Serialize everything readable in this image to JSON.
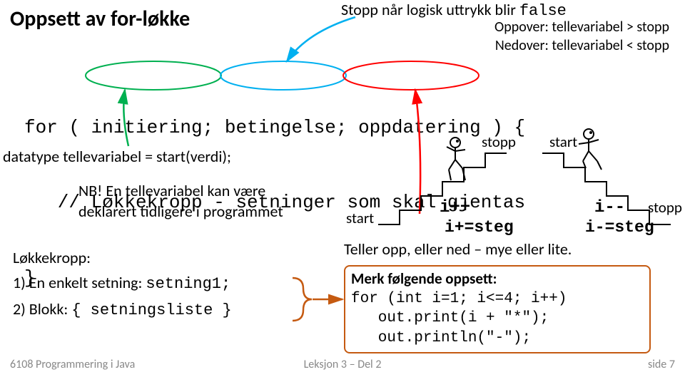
{
  "title": "Oppsett av for-løkke",
  "stop_note_a": "Stopp når logisk uttrykk blir ",
  "stop_note_b": "false",
  "oppover": "Oppover:  tellevariabel > stopp",
  "nedover": "Nedover:  tellevariabel < stopp",
  "code_line1": "for ( initiering; betingelse; oppdatering ) {",
  "code_line2": "   // Løkkekropp - setninger som skal gjentas",
  "code_line3": "}",
  "datatype": "datatype tellevariabel = start(verdi);",
  "nb_a": "NB!",
  "nb_b": "En tellevariabel kan være deklarert tidligere i programmet",
  "lokke_title": "Løkkekropp:",
  "lokke_1a": "1)  En enkelt setning: ",
  "lokke_1b": "setning1;",
  "lokke_2a": "2)  Blokk: ",
  "lokke_2b": "{ setningsliste }",
  "teller": "Teller opp, eller ned – mye eller lite.",
  "box_title": "Merk følgende oppsett:",
  "box_code": "for (int i=1; i<=4; i++)\n   out.print(i + \"*\");\n   out.println(\"-\");",
  "labels": {
    "start": "start",
    "stopp": "stopp",
    "ipp": "i++",
    "isteg": "i+=steg",
    "imm": "i--",
    "imsteg": "i-=steg"
  },
  "footer": {
    "left": "6108 Programmering i Java",
    "center": "Leksjon 3 – Del 2",
    "right": "side 7"
  }
}
